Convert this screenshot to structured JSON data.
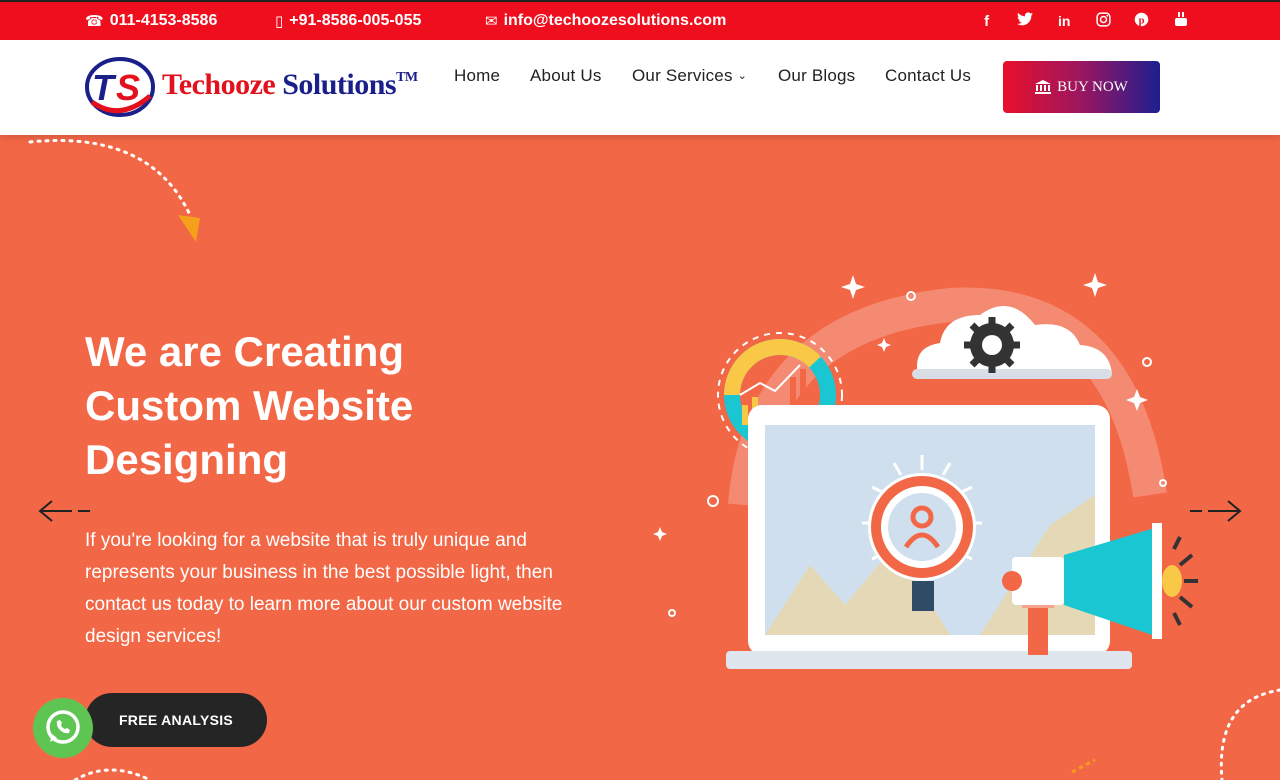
{
  "topbar": {
    "phone": "011-4153-8586",
    "mobile": "+91-8586-005-055",
    "email": "info@techoozesolutions.com",
    "socials": [
      "f",
      "t",
      "in",
      "ig",
      "p",
      "yt"
    ]
  },
  "brand": {
    "mark": "TS",
    "name_part1": "Techooze",
    "name_part2": "Solutions",
    "tm": "TM"
  },
  "nav": {
    "items": [
      "Home",
      "About Us",
      "Our Services",
      "Our Blogs",
      "Contact Us"
    ],
    "buy_label": "BUY NOW"
  },
  "hero": {
    "title": "We are Creating Custom Website Designing",
    "text": "If you're looking for a website that is truly unique and represents your business in the best possible light, then contact us today to learn more about our custom website design services!",
    "cta_label": "FREE ANALYSIS"
  },
  "colors": {
    "topbar": "#ef0e1e",
    "hero_bg": "#f26746",
    "buy_gradient_start": "#e8102a",
    "buy_gradient_end": "#1e1e90",
    "cta_bg": "#252525",
    "whatsapp": "#5ec553"
  },
  "icons": {
    "phone": "phone-icon",
    "mobile": "mobile-icon",
    "email": "envelope-icon",
    "bank": "bank-icon",
    "prev": "arrow-left-icon",
    "next": "arrow-right-icon",
    "whatsapp": "whatsapp-icon"
  }
}
